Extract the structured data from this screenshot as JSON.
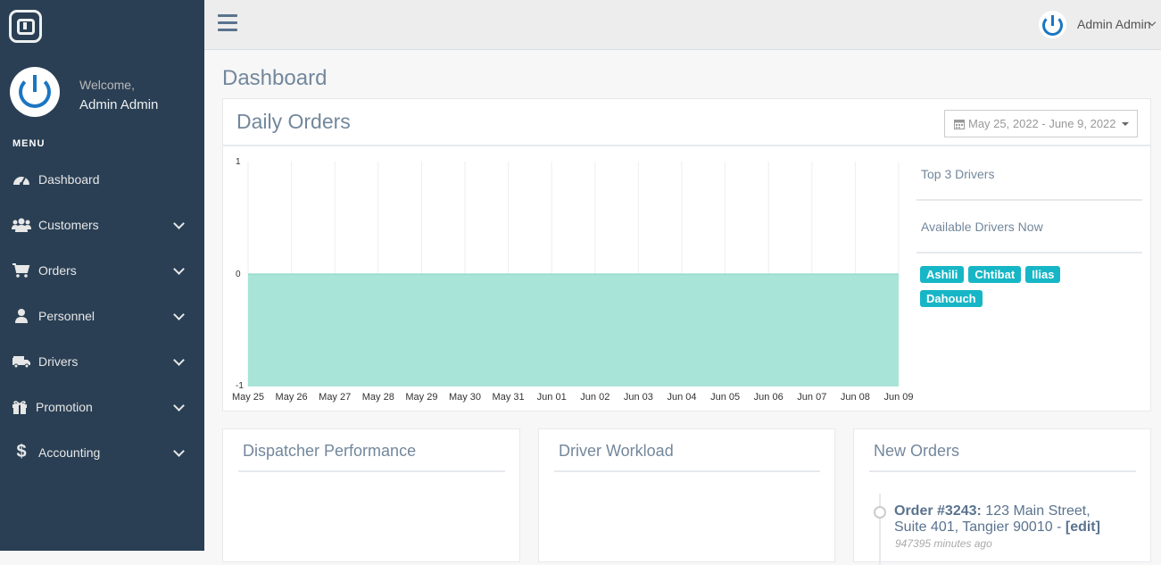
{
  "sidebar": {
    "welcome": "Welcome,",
    "user_name": "Admin Admin",
    "menu_title": "MENU",
    "items": [
      {
        "label": "Dashboard",
        "icon": "dashboard-icon",
        "expandable": false
      },
      {
        "label": "Customers",
        "icon": "users-icon",
        "expandable": true
      },
      {
        "label": "Orders",
        "icon": "cart-icon",
        "expandable": true
      },
      {
        "label": "Personnel",
        "icon": "user-icon",
        "expandable": true
      },
      {
        "label": "Drivers",
        "icon": "truck-icon",
        "expandable": true
      },
      {
        "label": "Promotion",
        "icon": "gift-icon",
        "expandable": true
      },
      {
        "label": "Accounting",
        "icon": "dollar-icon",
        "expandable": true
      }
    ]
  },
  "topbar": {
    "user_name": "Admin Admin"
  },
  "page": {
    "title": "Dashboard"
  },
  "daily_orders": {
    "title": "Daily Orders",
    "date_range": "May 25, 2022 - June 9, 2022",
    "side": {
      "top_drivers": "Top 3 Drivers",
      "available_drivers": "Available Drivers Now"
    },
    "drivers": [
      "Ashili",
      "Chtibat",
      "Ilias",
      "Dahouch"
    ]
  },
  "chart_data": {
    "type": "area",
    "x": [
      "May 25",
      "May 26",
      "May 27",
      "May 28",
      "May 29",
      "May 30",
      "May 31",
      "Jun 01",
      "Jun 02",
      "Jun 03",
      "Jun 04",
      "Jun 05",
      "Jun 06",
      "Jun 07",
      "Jun 08",
      "Jun 09"
    ],
    "series": [
      {
        "values": [
          0,
          0,
          0,
          0,
          0,
          0,
          0,
          0,
          0,
          0,
          0,
          0,
          0,
          0,
          0,
          0
        ]
      }
    ],
    "ylim": [
      -1,
      1
    ],
    "yticks": [
      "1",
      "0",
      "-1"
    ],
    "grid": "vertical",
    "color": "#a8e4d7"
  },
  "cards": {
    "dispatcher": {
      "title": "Dispatcher Performance"
    },
    "workload": {
      "title": "Driver Workload"
    },
    "new_orders": {
      "title": "New Orders",
      "order_label": "Order #3243:",
      "order_address": "123 Main Street, Suite 401, Tangier 90010 -",
      "edit_label": "[edit]",
      "time": "947395 minutes ago"
    }
  },
  "colors": {
    "sidebar": "#2A3F54",
    "accent": "#1b76c2",
    "badge": "#17b6c6"
  }
}
